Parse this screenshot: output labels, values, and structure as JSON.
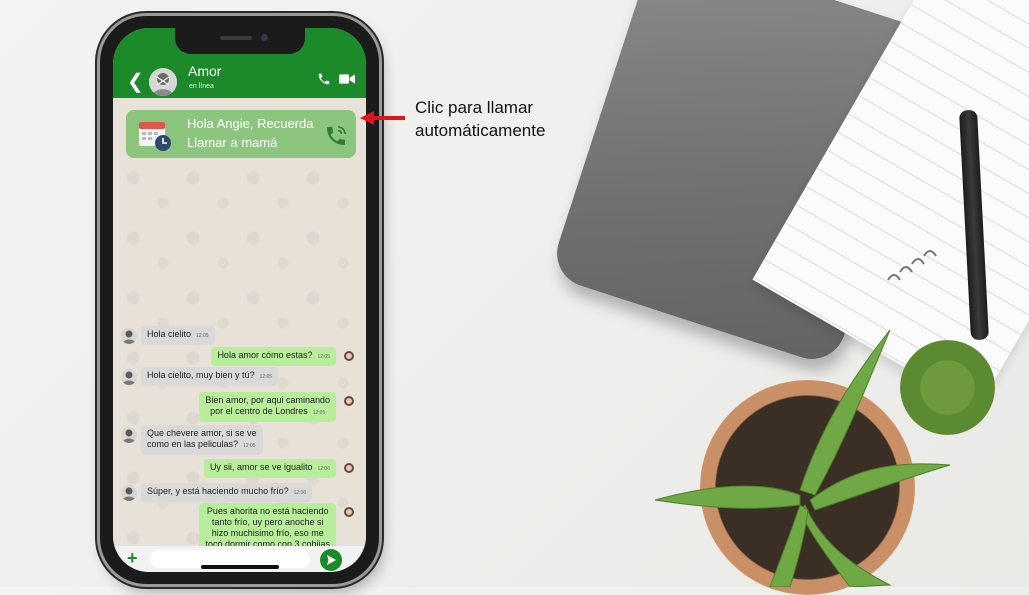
{
  "chat": {
    "contact_name": "Amor",
    "status": "en línea"
  },
  "reminder": {
    "line1": "Hola Angie, Recuerda",
    "line2": "Llamar a mamá"
  },
  "messages": [
    {
      "dir": "in",
      "lines": [
        "Hola cielito"
      ],
      "time": "12:05"
    },
    {
      "dir": "out",
      "lines": [
        "Hola amor cómo estas?"
      ],
      "time": "12:05"
    },
    {
      "dir": "in",
      "lines": [
        "Hola cielito, muy bien y tú?"
      ],
      "time": "12:05"
    },
    {
      "dir": "out",
      "lines": [
        "Bien amor, por aqui caminando",
        "por el centro de Londres"
      ],
      "time": "12:05"
    },
    {
      "dir": "in",
      "lines": [
        "Que chevere amor, si se ve",
        "como en las peliculas?"
      ],
      "time": "12:05"
    },
    {
      "dir": "out",
      "lines": [
        "Uy sii, amor se ve igualito"
      ],
      "time": "12:06"
    },
    {
      "dir": "in",
      "lines": [
        "Súper, y está haciendo mucho frío?"
      ],
      "time": "12:06"
    },
    {
      "dir": "out",
      "lines": [
        "Pues ahorita no está haciendo",
        "tanto frío, uy pero anoche si",
        "hizo muchisimo frío, eso me",
        "tocó dormir como con 3 cobijas"
      ],
      "time": ""
    }
  ],
  "composer": {
    "placeholder": ""
  },
  "annotation": {
    "line1": "Clic para llamar",
    "line2": "automáticamente"
  },
  "colors": {
    "header_green": "#1c8a2b",
    "reminder_green": "#8cc57e",
    "outgoing_bubble": "#b8ed9b",
    "incoming_bubble": "#d9d9d9",
    "arrow_red": "#e0141b"
  },
  "icons": [
    "back-arrow-icon",
    "avatar",
    "phone-call-icon",
    "video-camera-icon",
    "calendar-clock-icon",
    "ringing-phone-icon",
    "plus-icon",
    "send-icon"
  ]
}
